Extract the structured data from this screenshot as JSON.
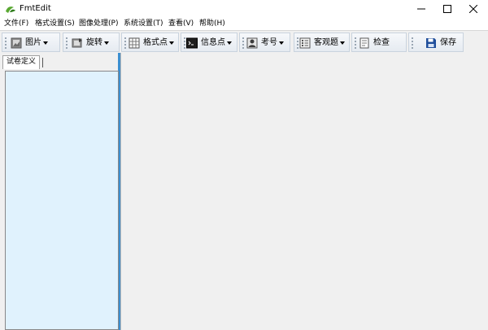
{
  "window": {
    "title": "FmtEdit",
    "minimize_icon": "minimize-icon",
    "maximize_icon": "maximize-icon",
    "close_icon": "close-icon"
  },
  "menu": [
    {
      "label": "文件(F)"
    },
    {
      "label": "格式设置(S)"
    },
    {
      "label": "图像处理(P)"
    },
    {
      "label": "系统设置(T)"
    },
    {
      "label": "查看(V)"
    },
    {
      "label": "帮助(H)"
    }
  ],
  "toolbar": {
    "image": {
      "label": "图片",
      "icon": "image-icon"
    },
    "rotate": {
      "label": "旋转",
      "icon": "rotate-icon"
    },
    "format_point": {
      "label": "格式点",
      "icon": "grid-icon"
    },
    "info_point": {
      "label": "信息点",
      "icon": "terminal-icon"
    },
    "exam_number": {
      "label": "考号",
      "icon": "id-card-icon"
    },
    "objective": {
      "label": "客观题",
      "icon": "checklist-icon"
    },
    "check": {
      "label": "检查",
      "icon": "document-check-icon"
    },
    "save": {
      "label": "保存",
      "icon": "save-icon"
    }
  },
  "left_panel": {
    "tab_label": "试卷定义"
  },
  "colors": {
    "accent": "#3c8fd0",
    "tree_background": "#e0f2fd",
    "workspace_background": "#f0f0f0"
  }
}
